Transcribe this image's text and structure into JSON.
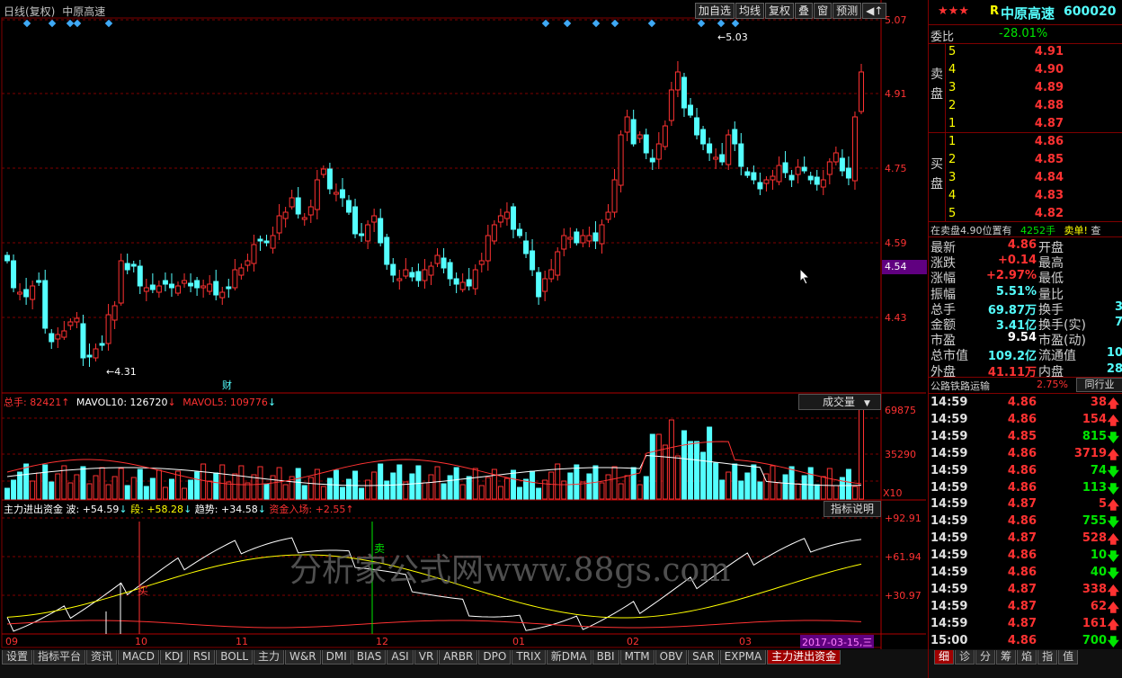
{
  "header": {
    "title": "日线(复权)",
    "stock_name": "中原高速",
    "buttons": [
      "加自选",
      "均线",
      "复权",
      "叠",
      "窗",
      "预测"
    ]
  },
  "price_axis": [
    "5.07",
    "4.91",
    "4.75",
    "4.59",
    "4.43"
  ],
  "current_price_tag": "4.54",
  "annotations": {
    "high": "5.03",
    "low": "4.31",
    "cai": "财",
    "buy": "买",
    "sell": "卖"
  },
  "volume_panel": {
    "label_total": "总手: 82421",
    "label_mavol10": "MAVOL10: 126720",
    "label_mavol5": "MAVOL5: 109776",
    "dropdown": "成交量",
    "axis": [
      "69875",
      "35290"
    ],
    "unit": "X10"
  },
  "indicator_panel": {
    "name": "主力进出资金",
    "wave": "波: +54.59",
    "segment": "段: +58.28",
    "trend": "趋势: +34.58",
    "inflow": "资金入场: +2.55",
    "help_button": "指标说明",
    "axis": [
      "+92.91",
      "+61.94",
      "+30.97"
    ]
  },
  "watermark": "分析家公式网www.88gs.com",
  "x_axis": {
    "labels": [
      "09",
      "10",
      "11",
      "12",
      "01",
      "02",
      "03"
    ],
    "date_tag": "2017-03-15,三"
  },
  "bottom_tabs": [
    "设置",
    "指标平台",
    "资讯",
    "MACD",
    "KDJ",
    "RSI",
    "BOLL",
    "主力",
    "W&R",
    "DMI",
    "BIAS",
    "ASI",
    "VR",
    "ARBR",
    "DPO",
    "TRIX",
    "新DMA",
    "BBI",
    "MTM",
    "OBV",
    "SAR",
    "EXPMA",
    "主力进出资金"
  ],
  "right_panel": {
    "stars": "★★★",
    "r_label": "R",
    "name": "中原高速",
    "code": "600020",
    "weibi_label": "委比",
    "weibi_value": "-28.01%",
    "sell_label": [
      "卖",
      "盘"
    ],
    "buy_label": [
      "买",
      "盘"
    ],
    "sell": [
      {
        "n": "5",
        "p": "4.91"
      },
      {
        "n": "4",
        "p": "4.90"
      },
      {
        "n": "3",
        "p": "4.89"
      },
      {
        "n": "2",
        "p": "4.88"
      },
      {
        "n": "1",
        "p": "4.87"
      }
    ],
    "buy": [
      {
        "n": "1",
        "p": "4.86"
      },
      {
        "n": "2",
        "p": "4.85"
      },
      {
        "n": "3",
        "p": "4.84"
      },
      {
        "n": "4",
        "p": "4.83"
      },
      {
        "n": "5",
        "p": "4.82"
      }
    ],
    "notice_left": "在卖盘4.90位置有",
    "notice_mid": "4252手",
    "notice_right": "卖单!",
    "notice_extra": "查",
    "stats": [
      {
        "l": "最新",
        "v": "4.86",
        "l2": "开盘",
        "v2": ""
      },
      {
        "l": "涨跌",
        "v": "+0.14",
        "l2": "最高",
        "v2": ""
      },
      {
        "l": "涨幅",
        "v": "+2.97%",
        "l2": "最低",
        "v2": ""
      },
      {
        "l": "振幅",
        "v": "5.51%",
        "l2": "量比",
        "v2": ""
      },
      {
        "l": "总手",
        "v": "69.87万",
        "l2": "换手",
        "v2": "3"
      },
      {
        "l": "金额",
        "v": "3.41亿",
        "l2": "换手(实)",
        "v2": "7"
      },
      {
        "l": "市盈",
        "v": "9.54",
        "l2": "市盈(动)",
        "v2": ""
      },
      {
        "l": "总市值",
        "v": "109.2亿",
        "l2": "流通值",
        "v2": "10"
      },
      {
        "l": "外盘",
        "v": "41.11万",
        "l2": "内盘",
        "v2": "28"
      }
    ],
    "industry": "公路铁路运输",
    "industry_pct": "2.75%",
    "industry_btn": "同行业",
    "ticks": [
      {
        "t": "14:59",
        "p": "4.86",
        "v": "38",
        "d": "up"
      },
      {
        "t": "14:59",
        "p": "4.86",
        "v": "154",
        "d": "up"
      },
      {
        "t": "14:59",
        "p": "4.85",
        "v": "815",
        "d": "down"
      },
      {
        "t": "14:59",
        "p": "4.86",
        "v": "3719",
        "d": "up"
      },
      {
        "t": "14:59",
        "p": "4.86",
        "v": "74",
        "d": "down"
      },
      {
        "t": "14:59",
        "p": "4.86",
        "v": "113",
        "d": "down"
      },
      {
        "t": "14:59",
        "p": "4.87",
        "v": "5",
        "d": "up"
      },
      {
        "t": "14:59",
        "p": "4.86",
        "v": "755",
        "d": "down"
      },
      {
        "t": "14:59",
        "p": "4.87",
        "v": "528",
        "d": "up"
      },
      {
        "t": "14:59",
        "p": "4.86",
        "v": "10",
        "d": "down"
      },
      {
        "t": "14:59",
        "p": "4.86",
        "v": "40",
        "d": "down"
      },
      {
        "t": "14:59",
        "p": "4.87",
        "v": "338",
        "d": "up"
      },
      {
        "t": "14:59",
        "p": "4.87",
        "v": "62",
        "d": "up"
      },
      {
        "t": "14:59",
        "p": "4.87",
        "v": "161",
        "d": "up"
      },
      {
        "t": "15:00",
        "p": "4.86",
        "v": "700",
        "d": "down"
      }
    ],
    "bottom_tabs": [
      "细",
      "诊",
      "分",
      "筹",
      "焰",
      "指",
      "值"
    ]
  }
}
